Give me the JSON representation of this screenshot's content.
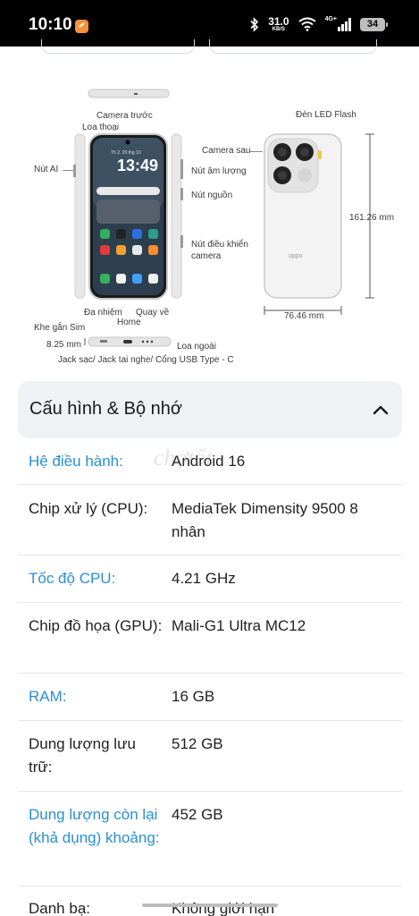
{
  "status_bar": {
    "time": "10:10",
    "speed_value": "31.0",
    "speed_unit": "KB/S",
    "network": "4G+",
    "battery": "34",
    "icons": [
      "bluetooth-icon",
      "wifi-icon",
      "signal-icon",
      "battery-icon"
    ]
  },
  "diagram": {
    "phone_screen_time": "13:49",
    "phone_screen_date": "Th 2, 20 thg 10",
    "labels": {
      "camera_front": "Camera trước",
      "earpiece": "Loa thoại",
      "ai_button": "Nút AI",
      "volume_button": "Nút âm lượng",
      "power_button": "Nút nguồn",
      "camera_control_1": "Nút điều khiển",
      "camera_control_2": "camera",
      "recent_apps": "Đa nhiệm",
      "back": "Quay về",
      "home": "Home",
      "rear_camera": "Camera sau",
      "led_flash": "Đèn LED Flash",
      "height": "161.26 mm",
      "width": "76.46 mm",
      "sim_slot": "Khe gắn Sim",
      "thickness": "8.25 mm",
      "speaker": "Loa ngoài",
      "ports": "Jack sạc/ Jack tai nghe/ Cổng USB Type - C"
    }
  },
  "specs": {
    "section_title": "Cấu hình & Bộ nhớ",
    "rows": [
      {
        "key": "Hệ điều hành:",
        "value": "Android 16",
        "highlight": true
      },
      {
        "key": "Chip xử lý (CPU):",
        "value": "MediaTek Dimensity 9500 8 nhân",
        "highlight": false
      },
      {
        "key": "Tốc độ CPU:",
        "value": "4.21 GHz",
        "highlight": true
      },
      {
        "key": "Chip đồ họa (GPU):",
        "value": "Mali-G1 Ultra MC12",
        "highlight": false
      },
      {
        "key": "RAM:",
        "value": "16 GB",
        "highlight": true
      },
      {
        "key": "Dung lượng lưu trữ:",
        "value": "512 GB",
        "highlight": false
      },
      {
        "key": "Dung lượng còn lại (khả dụng) khoảng:",
        "value": "452 GB",
        "highlight": true
      },
      {
        "key": "Danh bạ:",
        "value": "Không giới hạn",
        "highlight": false
      }
    ]
  },
  "colors": {
    "accent_blue": "#2a8fd6",
    "header_bg": "#f0f1f5",
    "status_bg": "#000000"
  }
}
